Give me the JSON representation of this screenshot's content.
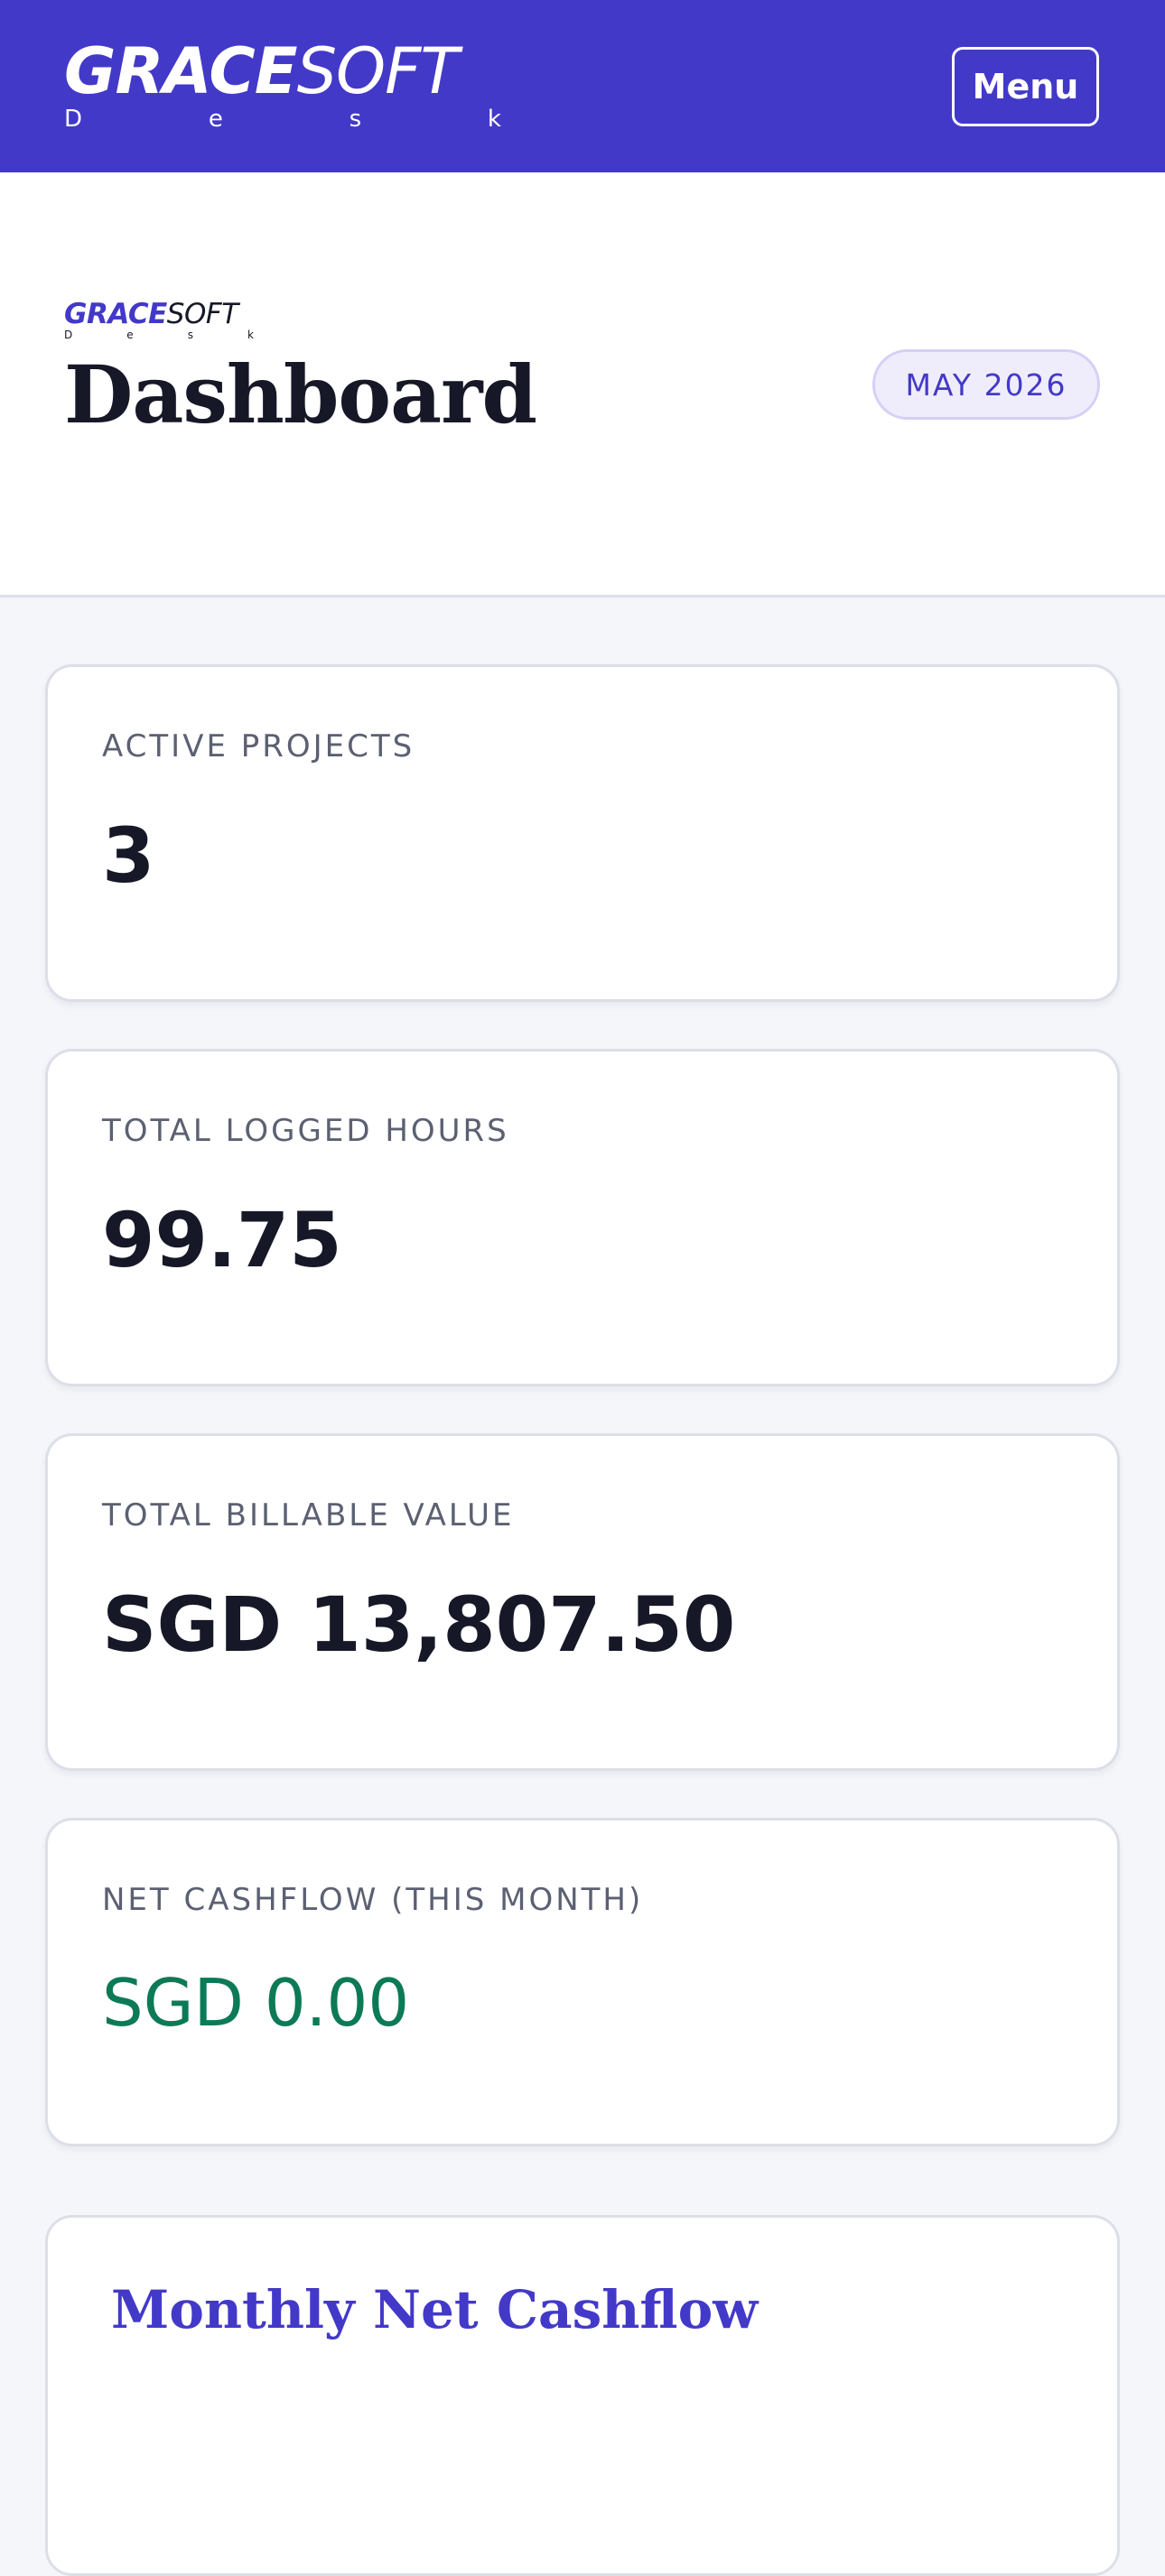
{
  "app": {
    "brand_strong": "GRACE",
    "brand_light": "SOFT",
    "brand_sub_letters": [
      "D",
      "e",
      "s",
      "k"
    ],
    "menu_label": "Menu"
  },
  "header": {
    "logo_strong": "GRACE",
    "logo_light": "SOFT",
    "title": "Dashboard",
    "period": "MAY 2026"
  },
  "stats": [
    {
      "label": "ACTIVE PROJECTS",
      "value": "3"
    },
    {
      "label": "TOTAL LOGGED HOURS",
      "value": "99.75"
    },
    {
      "label": "TOTAL BILLABLE VALUE",
      "value": "SGD 13,807.50"
    },
    {
      "label": "NET CASHFLOW (THIS MONTH)",
      "value": "SGD 0.00"
    }
  ],
  "chart_section": {
    "title": "Monthly Net Cashflow"
  },
  "colors": {
    "brand": "#4339c8",
    "positive": "#0c7a56",
    "pill_bg": "#efedfc"
  }
}
